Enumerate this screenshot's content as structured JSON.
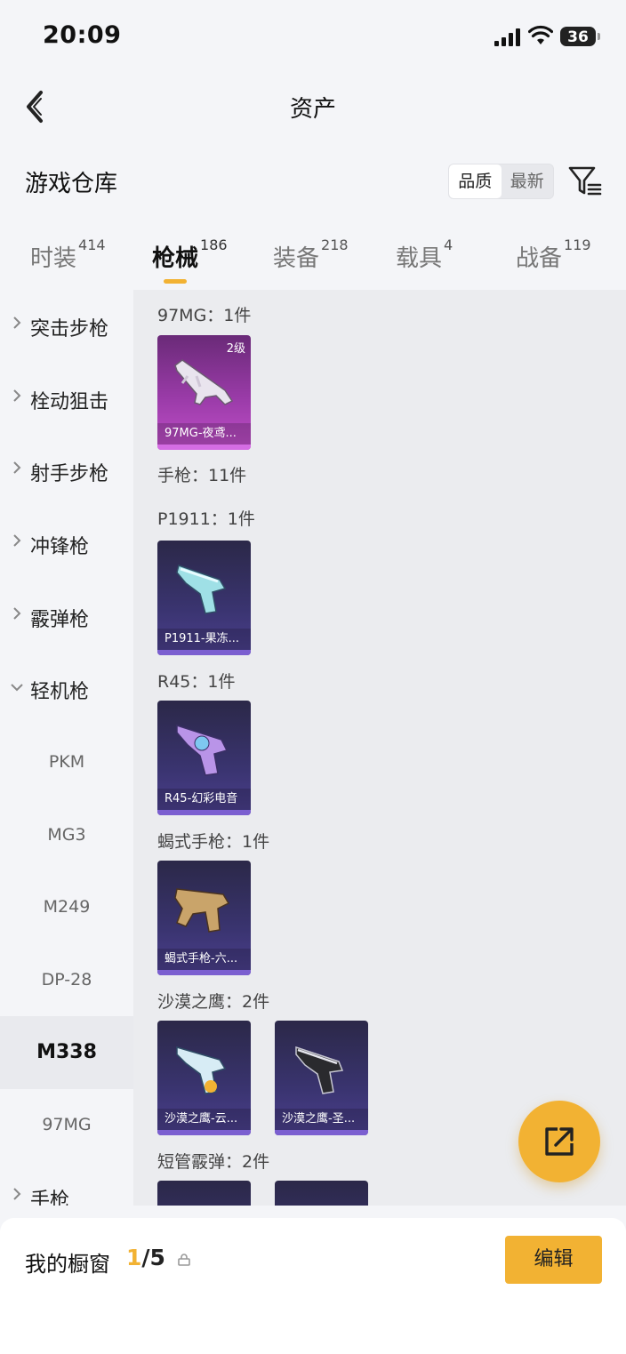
{
  "status_bar": {
    "time": "20:09",
    "battery": "36"
  },
  "header": {
    "title": "资产",
    "back_icon": "chevron-left-icon"
  },
  "section": {
    "title": "游戏仓库",
    "sort_options": [
      "品质",
      "最新"
    ],
    "sort_selected": "品质"
  },
  "tabs": [
    {
      "label": "时装",
      "count": "414"
    },
    {
      "label": "枪械",
      "count": "186",
      "active": true
    },
    {
      "label": "装备",
      "count": "218"
    },
    {
      "label": "载具",
      "count": "4"
    },
    {
      "label": "战备",
      "count": "119"
    }
  ],
  "sidebar": {
    "categories": [
      "突击步枪",
      "栓动狙击",
      "射手步枪",
      "冲锋枪",
      "霰弹枪",
      "轻机枪"
    ],
    "subitems": [
      "PKM",
      "MG3",
      "M249",
      "DP-28",
      "M338",
      "97MG"
    ],
    "active_subitem": "M338",
    "last_category": "手枪"
  },
  "groups": [
    {
      "title": "97MG：1件",
      "items": [
        {
          "name": "97MG-夜鸢...",
          "level": "2级"
        }
      ]
    },
    {
      "title": "手枪：11件",
      "items": []
    },
    {
      "title": "P1911：1件",
      "items": [
        {
          "name": "P1911-果冻..."
        }
      ]
    },
    {
      "title": "R45：1件",
      "items": [
        {
          "name": "R45-幻彩电音"
        }
      ]
    },
    {
      "title": "蝎式手枪：1件",
      "items": [
        {
          "name": "蝎式手枪-六..."
        }
      ]
    },
    {
      "title": "沙漠之鹰：2件",
      "items": [
        {
          "name": "沙漠之鹰-云..."
        },
        {
          "name": "沙漠之鹰-圣..."
        }
      ]
    },
    {
      "title": "短管霰弹：2件",
      "items": []
    }
  ],
  "bottom_bar": {
    "title": "我的橱窗",
    "current": "1",
    "total": "/5",
    "edit_label": "编辑"
  },
  "colors": {
    "accent": "#f2b233",
    "card_bg": "#3a3470",
    "card_purple": "#9a3ba8"
  }
}
